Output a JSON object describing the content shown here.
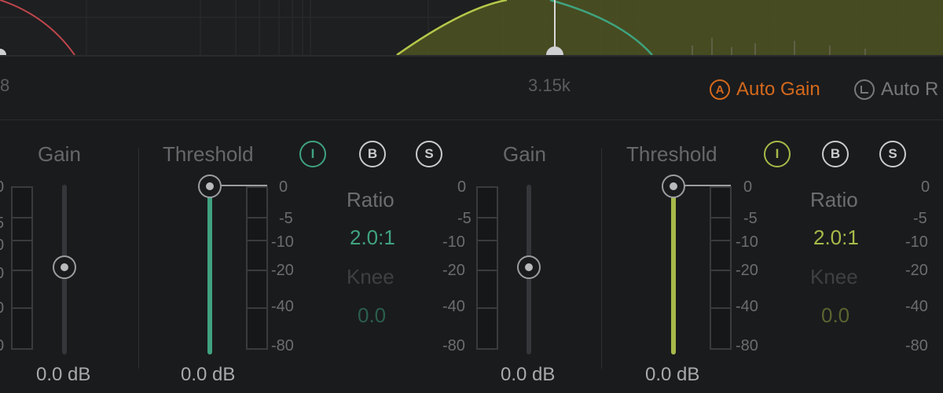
{
  "spectrum": {
    "colors": {
      "band_left": "#c0464c",
      "band_teal": "#3fa37f",
      "band_yellow": "#b5c74a"
    }
  },
  "freqbar": {
    "left_freq_partial": "8",
    "center_freq": "3.15k",
    "auto_gain": {
      "label": "Auto Gain",
      "icon": "auto-gain-icon",
      "glyph": "A",
      "color": "#d4691c"
    },
    "auto_partial": {
      "label": "Auto R",
      "icon": "auto-release-icon"
    }
  },
  "labels": {
    "gain": "Gain",
    "threshold": "Threshold",
    "ratio": "Ratio",
    "knee": "Knee"
  },
  "scale_values": [
    "0",
    "-5",
    "-10",
    "-20",
    "-40",
    "-80"
  ],
  "bands": [
    {
      "id": "band-teal",
      "accent": "#3fa37f",
      "gain_value": "0.0 dB",
      "threshold_value": "0.0 dB",
      "ratio_value": "2.0:1",
      "knee_value": "0.0",
      "buttons": {
        "i": "I",
        "b": "B",
        "s": "S"
      }
    },
    {
      "id": "band-yellow",
      "accent": "#a8b949",
      "gain_value": "0.0 dB",
      "threshold_value": "0.0 dB",
      "ratio_value": "2.0:1",
      "knee_value": "0.0",
      "buttons": {
        "i": "I",
        "b": "B",
        "s": "S"
      }
    }
  ],
  "left_partial": {
    "gain_value": "0.0 dB"
  }
}
